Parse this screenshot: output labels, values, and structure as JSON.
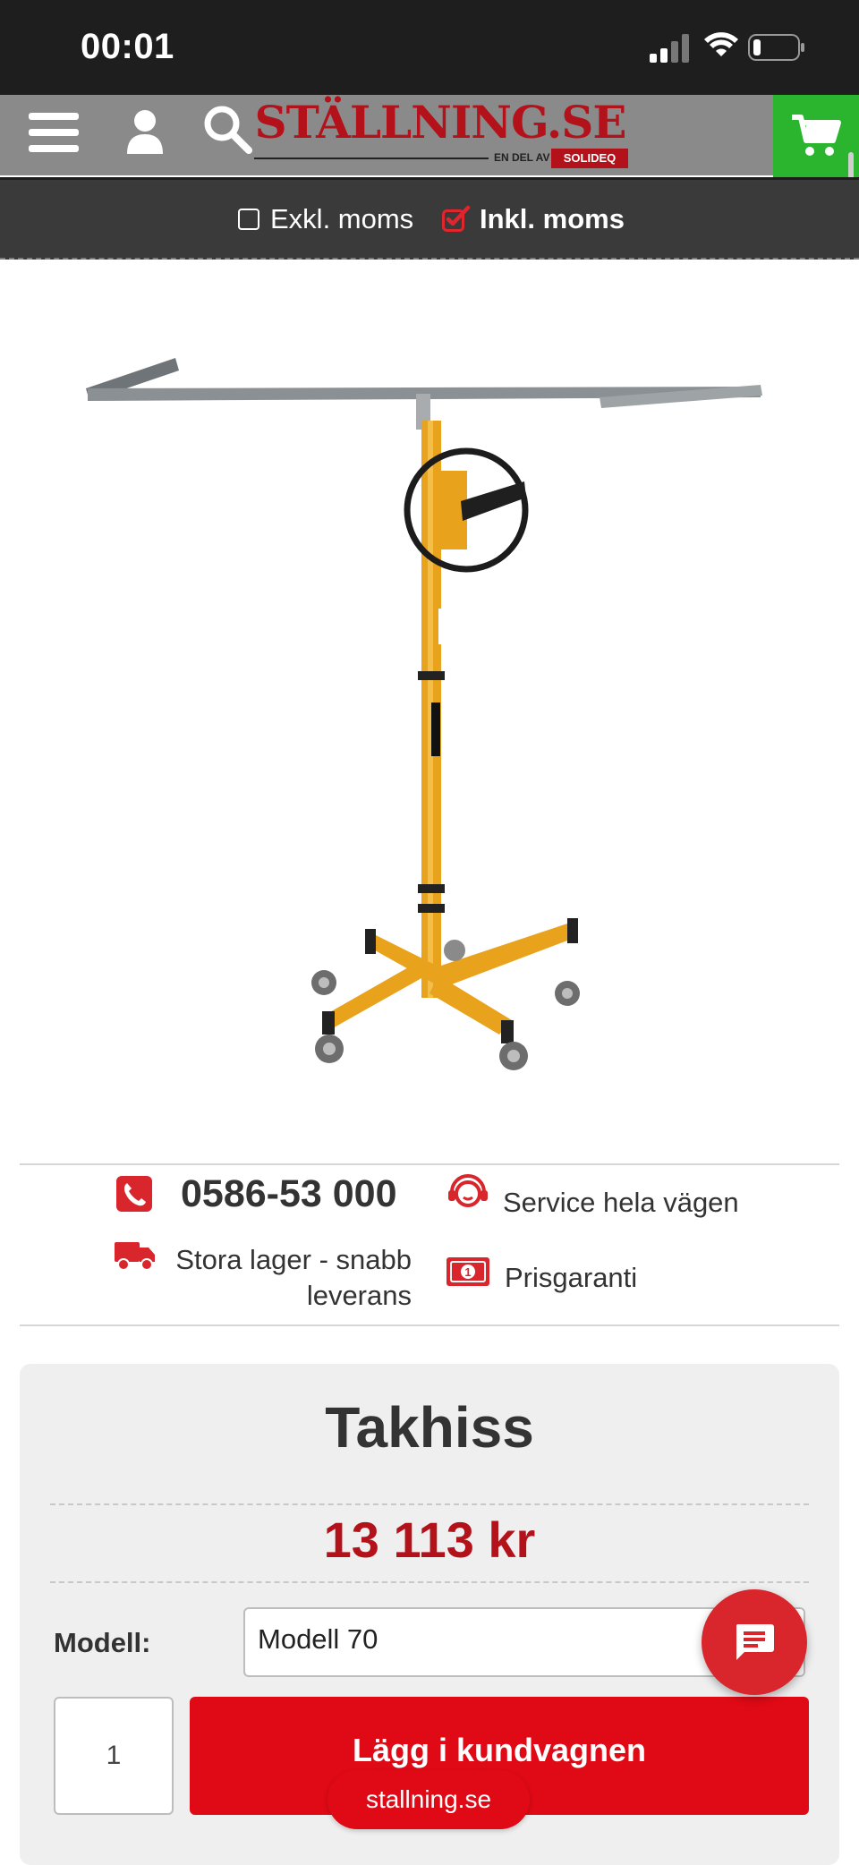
{
  "status_bar": {
    "time": "00:01",
    "icons": [
      "cellular-signal-icon",
      "wifi-icon",
      "battery-icon"
    ]
  },
  "header": {
    "logo_text": "STÄLLNING.SE",
    "logo_sub": "EN DEL AV",
    "logo_badge": "SOLIDEQ",
    "icons": [
      "menu-icon",
      "user-icon",
      "search-icon",
      "cart-icon"
    ],
    "cart_color": "#2bb52f",
    "brand_color": "#b3121b"
  },
  "vat_toggle": {
    "excl_label": "Exkl. moms",
    "incl_label": "Inkl. moms",
    "selected": "incl"
  },
  "usps": {
    "phone": "0586-53 000",
    "service": "Service hela vägen",
    "stock": "Stora lager - snabb leverans",
    "price_guarantee": "Prisgaranti"
  },
  "product": {
    "title": "Takhiss",
    "price": "13 113 kr",
    "model_label": "Modell:",
    "model_value": "Modell 70",
    "quantity": "1",
    "add_to_cart_label": "Lägg i kundvagnen"
  },
  "bottom": {
    "url": "stallning.se"
  },
  "colors": {
    "price": "#b3121b",
    "add_to_cart": "#e00a16",
    "chat": "#d8262c"
  }
}
